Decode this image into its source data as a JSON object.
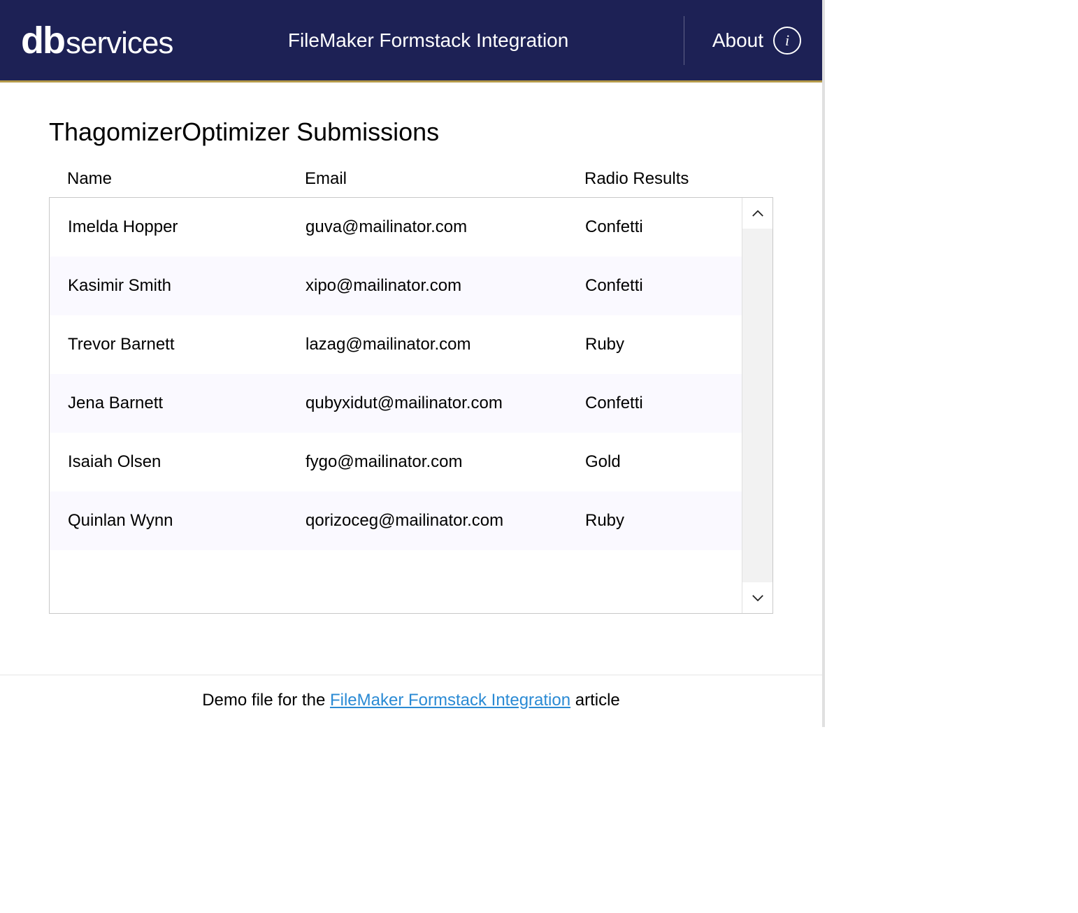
{
  "header": {
    "logo_bold": "db",
    "logo_rest": "services",
    "title": "FileMaker Formstack Integration",
    "about_label": "About"
  },
  "page": {
    "title": "ThagomizerOptimizer Submissions"
  },
  "columns": {
    "name": "Name",
    "email": "Email",
    "radio": "Radio Results"
  },
  "rows": [
    {
      "name": "Imelda Hopper",
      "email": "guva@mailinator.com",
      "radio": "Confetti"
    },
    {
      "name": "Kasimir Smith",
      "email": "xipo@mailinator.com",
      "radio": "Confetti"
    },
    {
      "name": "Trevor Barnett",
      "email": "lazag@mailinator.com",
      "radio": "Ruby"
    },
    {
      "name": "Jena Barnett",
      "email": "qubyxidut@mailinator.com",
      "radio": "Confetti"
    },
    {
      "name": "Isaiah Olsen",
      "email": "fygo@mailinator.com",
      "radio": "Gold"
    },
    {
      "name": "Quinlan Wynn",
      "email": "qorizoceg@mailinator.com",
      "radio": "Ruby"
    }
  ],
  "footer": {
    "prefix": "Demo file for the ",
    "link_text": "FileMaker Formstack Integration",
    "suffix": " article"
  }
}
